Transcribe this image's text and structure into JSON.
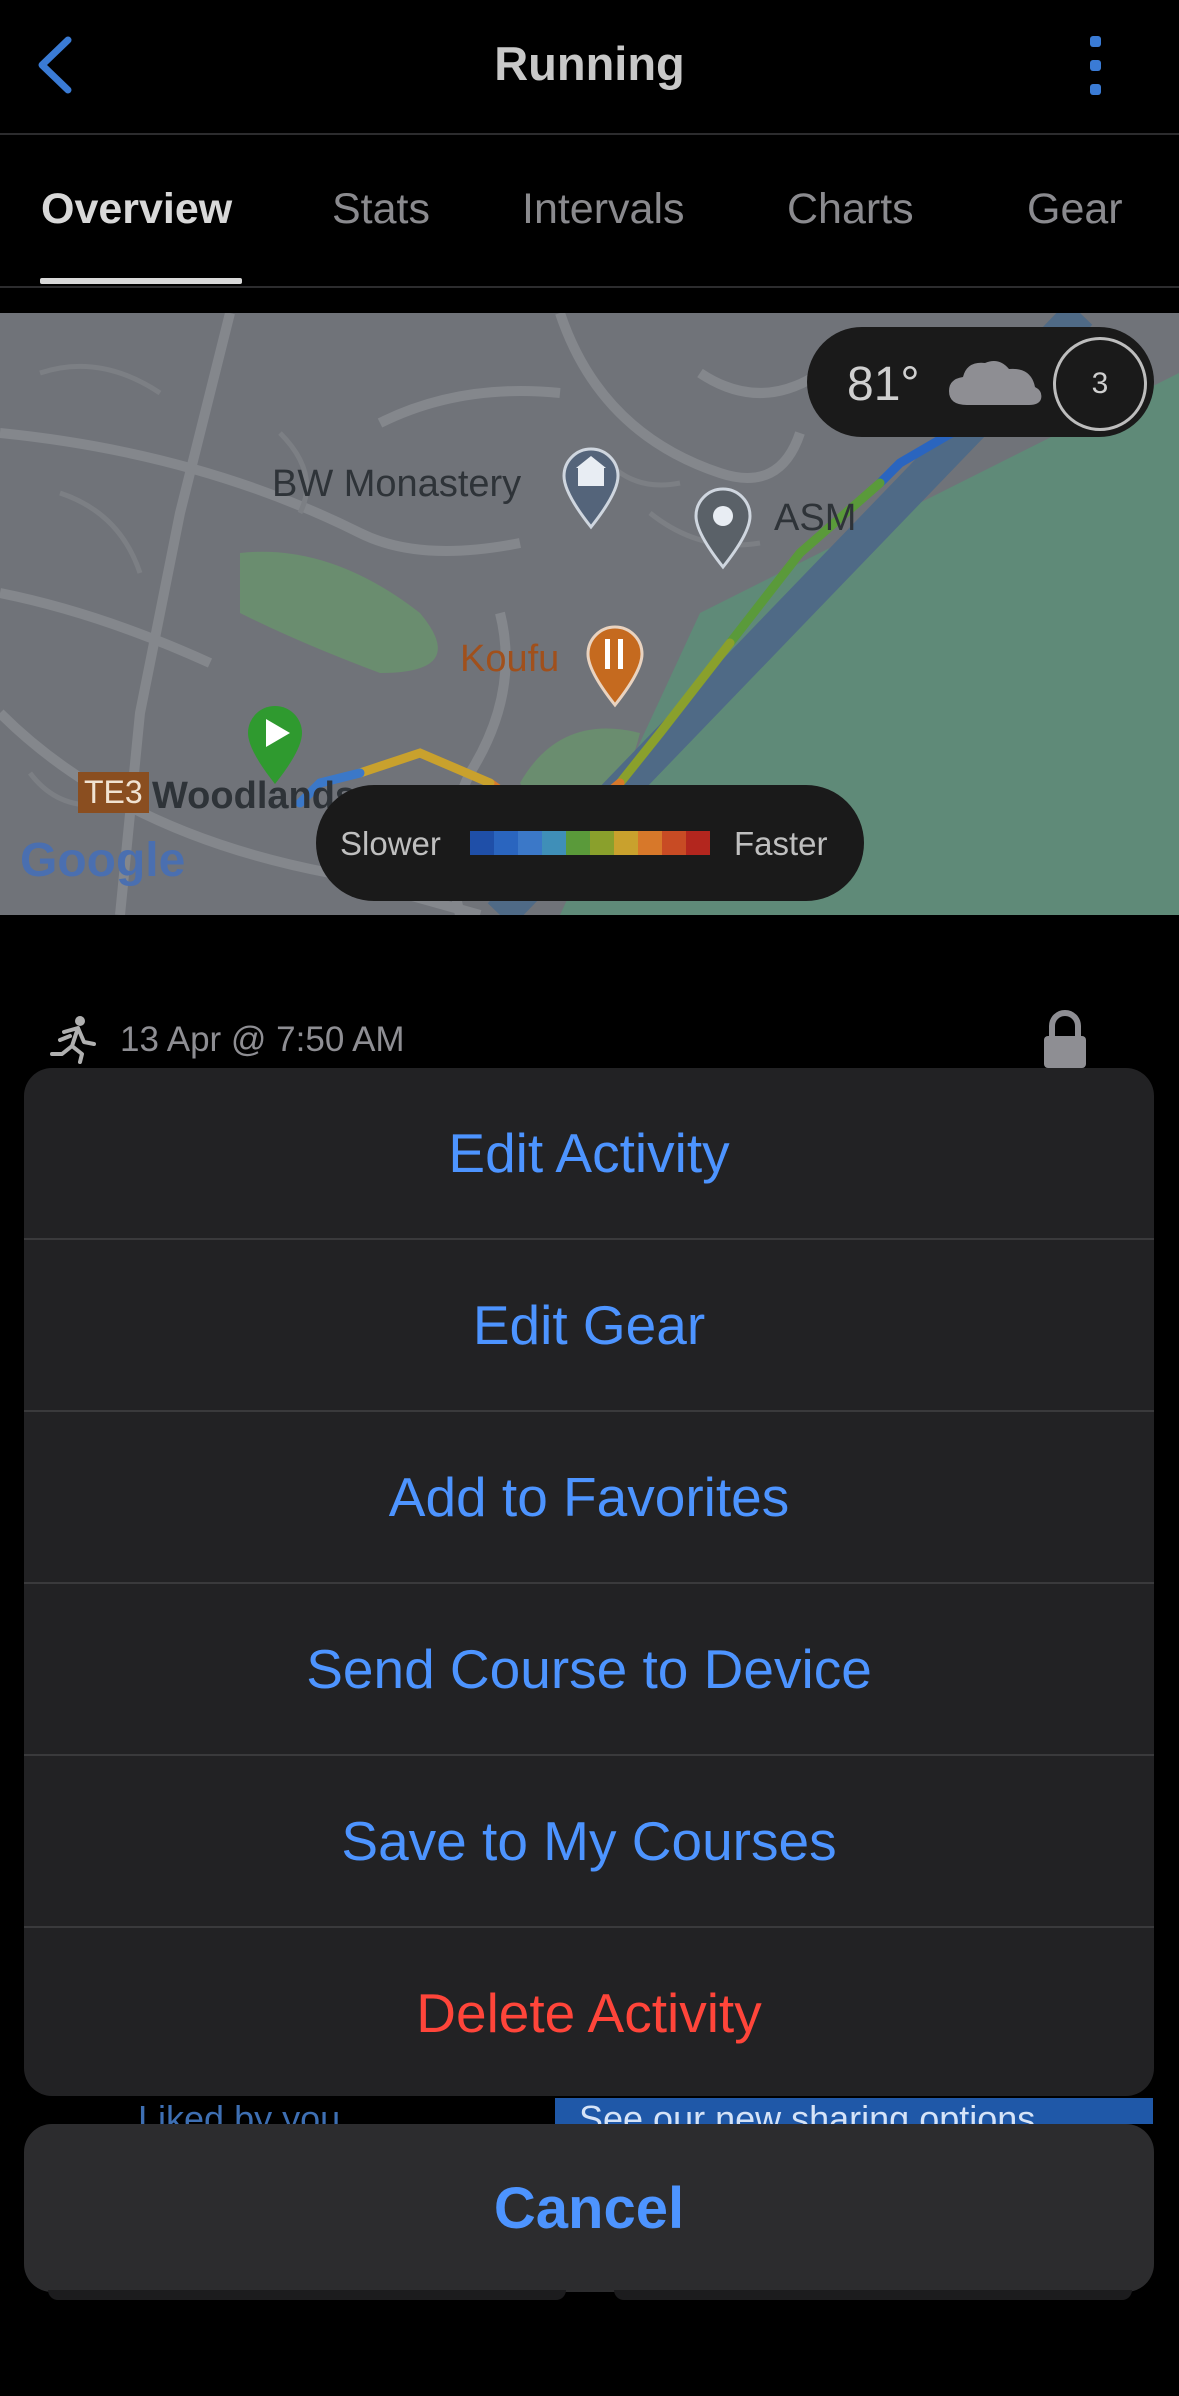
{
  "header": {
    "title": "Running",
    "back_icon": "chevron-left-icon",
    "more_icon": "more-vertical-icon"
  },
  "tabs": [
    {
      "label": "Overview",
      "active": true
    },
    {
      "label": "Stats",
      "active": false
    },
    {
      "label": "Intervals",
      "active": false
    },
    {
      "label": "Charts",
      "active": false
    },
    {
      "label": "Gear",
      "active": false
    }
  ],
  "map": {
    "labels": {
      "bw_monastery": "BW Monastery",
      "asm": "ASM",
      "koufu": "Koufu",
      "te3_badge": "TE3",
      "woodlands": "Woodlands",
      "google": "Google"
    },
    "weather": {
      "temperature": "81°",
      "icon": "cloud-icon",
      "uv_index": "3"
    },
    "legend": {
      "slower": "Slower",
      "faster": "Faster",
      "colors": [
        "#1f4fa8",
        "#2a65bf",
        "#3b78c8",
        "#3f8fb8",
        "#5a9a3a",
        "#8aa02c",
        "#c9a12d",
        "#d7782a",
        "#c84b24",
        "#b3261e"
      ]
    }
  },
  "activity": {
    "date_time": "13 Apr @ 7:50 AM",
    "activity_icon": "running-icon",
    "lock_icon": "lock-icon"
  },
  "action_sheet": {
    "items": [
      {
        "label": "Edit Activity",
        "destructive": false
      },
      {
        "label": "Edit Gear",
        "destructive": false
      },
      {
        "label": "Add to Favorites",
        "destructive": false
      },
      {
        "label": "Send Course to Device",
        "destructive": false
      },
      {
        "label": "Save to My Courses",
        "destructive": false
      },
      {
        "label": "Delete Activity",
        "destructive": true
      }
    ],
    "cancel_label": "Cancel"
  },
  "behind": {
    "liked_text": "Liked by you",
    "sharing_text": "See our new sharing options"
  }
}
